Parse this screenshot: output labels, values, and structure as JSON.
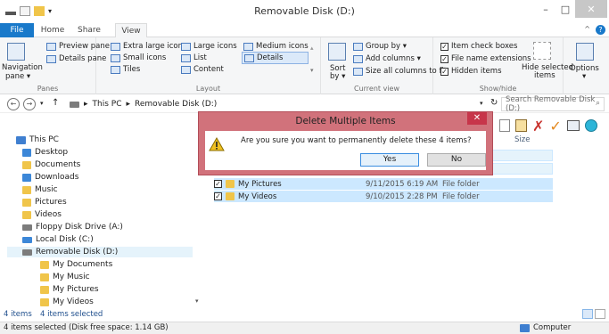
{
  "window": {
    "title": "Removable Disk (D:)",
    "minimize": "–",
    "maximize": "□",
    "close": "✕"
  },
  "ribbon_tabs": [
    "File",
    "Home",
    "Share",
    "View"
  ],
  "ribbon": {
    "panes": {
      "navigation_pane": "Navigation",
      "navigation_pane_2": "pane ▾",
      "preview_pane": "Preview pane",
      "details_pane": "Details pane",
      "label": "Panes"
    },
    "layout": {
      "items": [
        "Extra large icons",
        "Large icons",
        "Medium icons",
        "Small icons",
        "List",
        "Details",
        "Tiles",
        "Content"
      ],
      "label": "Layout"
    },
    "current_view": {
      "sort_by": "Sort",
      "sort_by_2": "by ▾",
      "group_by": "Group by ▾",
      "add_columns": "Add columns ▾",
      "size_all": "Size all columns to fit",
      "label": "Current view"
    },
    "show_hide": {
      "item_check_boxes": "Item check boxes",
      "file_name_extensions": "File name extensions",
      "hidden_items": "Hidden items",
      "hide_selected_1": "Hide selected",
      "hide_selected_2": "items",
      "label": "Show/hide"
    },
    "options": {
      "label": "Options",
      "arrow": "▾"
    }
  },
  "address": {
    "path_root": "This PC",
    "path_sep": "▸",
    "path_leaf": "Removable Disk (D:)",
    "search_placeholder": "Search Removable Disk (D:)"
  },
  "nav_pane": {
    "this_pc": "This PC",
    "items": [
      "Desktop",
      "Documents",
      "Downloads",
      "Music",
      "Pictures",
      "Videos",
      "Floppy Disk Drive (A:)",
      "Local Disk (C:)",
      "Removable Disk (D:)"
    ],
    "sub_items": [
      "My Documents",
      "My Music",
      "My Pictures",
      "My Videos"
    ]
  },
  "content": {
    "size_header": "Size",
    "rows": [
      {
        "name": "My Pictures",
        "date": "9/11/2015 6:19 AM",
        "type": "File folder"
      },
      {
        "name": "My Videos",
        "date": "9/10/2015 2:28 PM",
        "type": "File folder"
      }
    ]
  },
  "status": {
    "items_count": "4 items",
    "selected": "4 items selected",
    "bottom": "4 items selected (Disk free space: 1.14 GB)",
    "computer": "Computer"
  },
  "dialog": {
    "title": "Delete Multiple Items",
    "message": "Are you sure you want to permanently delete these 4 items?",
    "yes": "Yes",
    "no": "No",
    "close": "✕"
  }
}
